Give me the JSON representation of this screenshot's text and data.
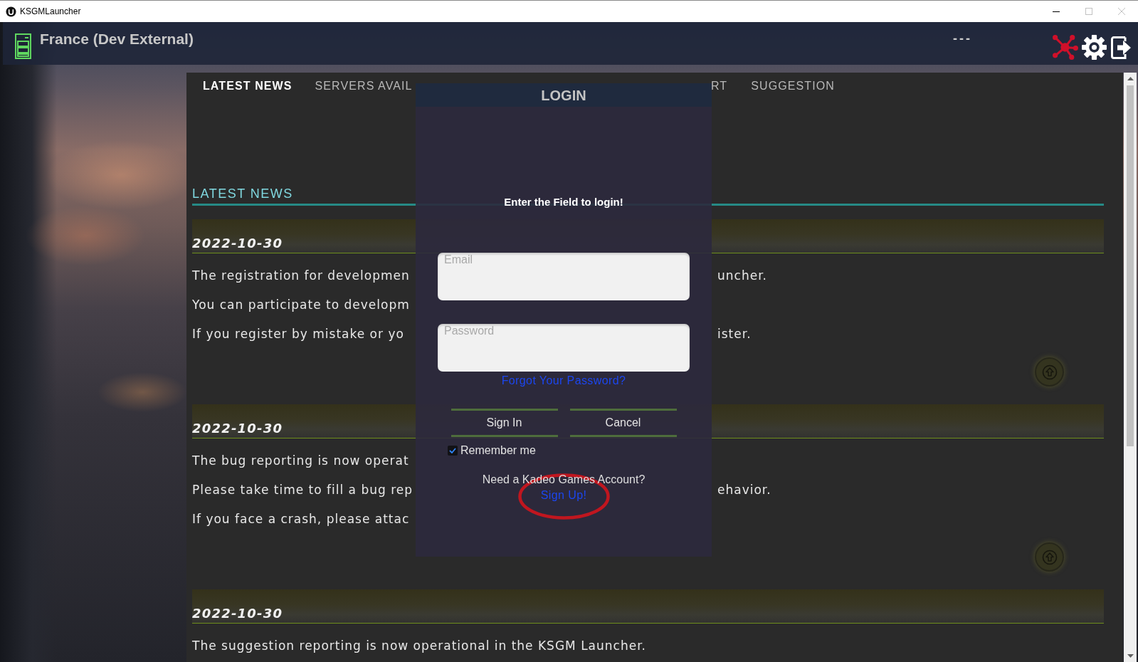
{
  "window": {
    "title": "KSGMLauncher",
    "controls": [
      {
        "kind": "minimize",
        "disabled": false
      },
      {
        "kind": "maximize",
        "disabled": true
      },
      {
        "kind": "close",
        "disabled": true
      }
    ]
  },
  "header": {
    "server_name": "France (Dev External)",
    "status": "---"
  },
  "tabs": {
    "before_dialog": [
      {
        "label": "LATEST NEWS",
        "selected": true
      },
      {
        "label": "SERVERS AVAIL",
        "selected": false
      }
    ],
    "after_dialog": [
      {
        "label": "RT",
        "selected": false
      },
      {
        "label": "SUGGESTION",
        "selected": false
      }
    ]
  },
  "news": {
    "heading": "LATEST NEWS",
    "posts": [
      {
        "date": "2022-10-30",
        "lines": [
          {
            "before_dialog": "The registration for developmen",
            "after_dialog": "uncher."
          },
          {
            "before_dialog": "You can participate to developm"
          },
          {
            "before_dialog": "If you register by mistake or yo",
            "after_dialog": "ister."
          }
        ],
        "top_button": true
      },
      {
        "date": "2022-10-30",
        "lines": [
          {
            "before_dialog": "The bug reporting is now operat"
          },
          {
            "before_dialog": "Please take time to fill a bug rep",
            "after_dialog": "ehavior."
          },
          {
            "before_dialog": "If you face a crash, please attac"
          }
        ],
        "top_button": true
      },
      {
        "date": "2022-10-30",
        "lines": [
          {
            "text": "The suggestion reporting is now operational in the KSGM Launcher."
          }
        ]
      }
    ]
  },
  "login": {
    "title": "LOGIN",
    "prompt": "Enter the Field to login!",
    "email": {
      "placeholder": "Email"
    },
    "password": {
      "placeholder": "Password"
    },
    "forgot_link": "Forgot Your Password?",
    "buttons": [
      "Sign In",
      "Cancel"
    ],
    "remember": {
      "label": "Remember me",
      "checked": true
    },
    "signup_prompt": "Need a Kadeo Games Account?",
    "signup_link": "Sign Up!"
  }
}
